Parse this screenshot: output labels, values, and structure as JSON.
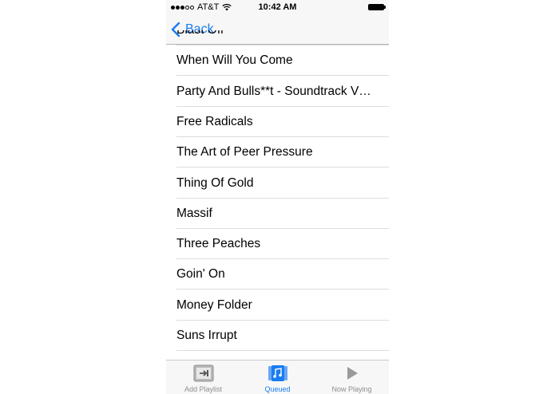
{
  "status_bar": {
    "carrier": "AT&T",
    "time": "10:42 AM",
    "signal_icon": "signal-dots-icon",
    "wifi_icon": "wifi-icon",
    "battery_icon": "battery-icon"
  },
  "nav": {
    "back_label": "Back",
    "back_icon": "chevron-left-icon",
    "accent_color": "#1a7cf0"
  },
  "songs": [
    "Blast Off",
    "When Will You Come",
    "Party And Bulls**t - Soundtrack V…",
    "Free Radicals",
    "The Art of Peer Pressure",
    "Thing Of Gold",
    "Massif",
    "Three Peaches",
    "Goin' On",
    "Money Folder",
    "Suns Irrupt"
  ],
  "tabs": [
    {
      "label": "Add Playlist",
      "icon": "add-playlist-icon",
      "active": false
    },
    {
      "label": "Queued",
      "icon": "queued-music-icon",
      "active": true
    },
    {
      "label": "Now Playing",
      "icon": "play-icon",
      "active": false
    }
  ]
}
